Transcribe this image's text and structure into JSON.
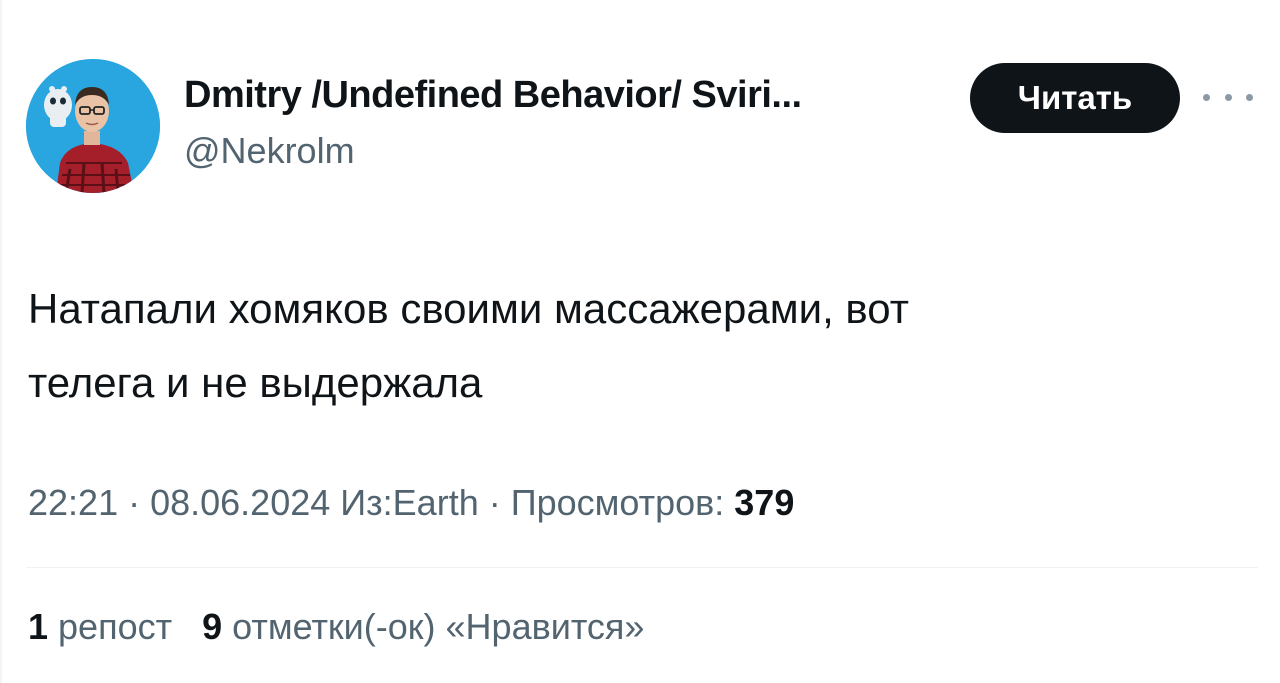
{
  "author": {
    "display_name": "Dmitry /Undefined Behavior/ Sviri...",
    "handle": "@Nekrolm"
  },
  "actions": {
    "follow_label": "Читать",
    "more_icon": "more-horizontal-icon"
  },
  "tweet": {
    "text_line1": "Натапали хомяков своими массажерами, вот",
    "text_line2": "телега и не выдержала"
  },
  "meta": {
    "time": "22:21",
    "separator1": " · ",
    "date": "08.06.2024",
    "source": " Из:Earth",
    "separator2": " · ",
    "views_label": "Просмотров: ",
    "views_count": "379"
  },
  "stats": {
    "reposts_count": "1",
    "reposts_label": " репост",
    "likes_count": "9",
    "likes_label": " отметки(-ок) «Нравится»"
  },
  "colors": {
    "text_primary": "#0f1419",
    "text_secondary": "#536471",
    "button_bg": "#0f1419",
    "avatar_bg": "#29a6e0"
  }
}
